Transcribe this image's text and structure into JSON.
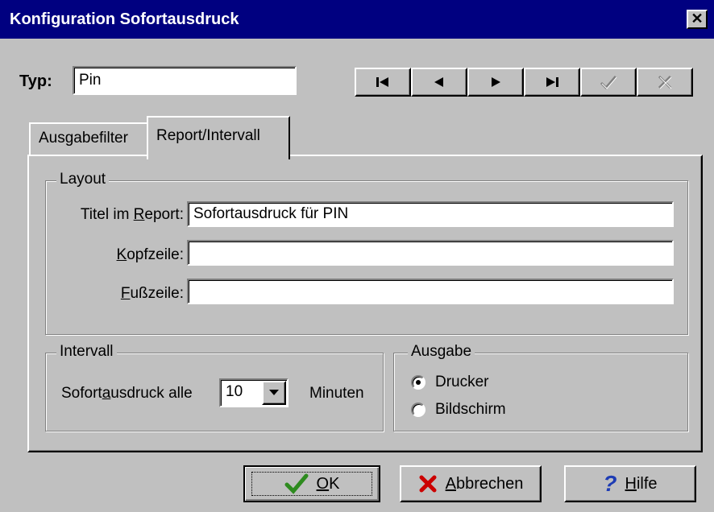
{
  "window": {
    "title": "Konfiguration Sofortausdruck"
  },
  "typ": {
    "label": "Typ:",
    "value": "Pin"
  },
  "nav": {
    "first": "first-icon",
    "prev": "prev-icon",
    "next": "next-icon",
    "last": "last-icon",
    "confirm": "check-icon",
    "cancel": "x-icon"
  },
  "tabs": [
    {
      "label": "Ausgabefilter",
      "active": false
    },
    {
      "label": "Report/Intervall",
      "active": true
    }
  ],
  "layout": {
    "legend": "Layout",
    "titel": {
      "label_pre": "Titel im ",
      "label_key": "R",
      "label_post": "eport:",
      "value": "Sofortausdruck für PIN"
    },
    "kopf": {
      "label_pre": "",
      "label_key": "K",
      "label_post": "opfzeile:",
      "value": ""
    },
    "fuss": {
      "label_pre": "",
      "label_key": "F",
      "label_post": "ußzeile:",
      "value": ""
    }
  },
  "intervall": {
    "legend": "Intervall",
    "label_pre": "Sofort",
    "label_key": "a",
    "label_post": "usdruck alle",
    "value": "10",
    "unit": "Minuten"
  },
  "ausgabe": {
    "legend": "Ausgabe",
    "options": [
      {
        "label": "Drucker",
        "selected": true
      },
      {
        "label": "Bildschirm",
        "selected": false
      }
    ]
  },
  "buttons": {
    "ok": {
      "key": "O",
      "rest": "K"
    },
    "abbrechen": {
      "key": "A",
      "rest": "bbrechen"
    },
    "hilfe": {
      "key": "H",
      "rest": "ilfe"
    }
  },
  "colors": {
    "titlebar": "#000080",
    "face": "#c0c0c0",
    "ok_check": "#2e8b1f",
    "cancel_x": "#cc0000",
    "help_q": "#1e3cb4"
  }
}
